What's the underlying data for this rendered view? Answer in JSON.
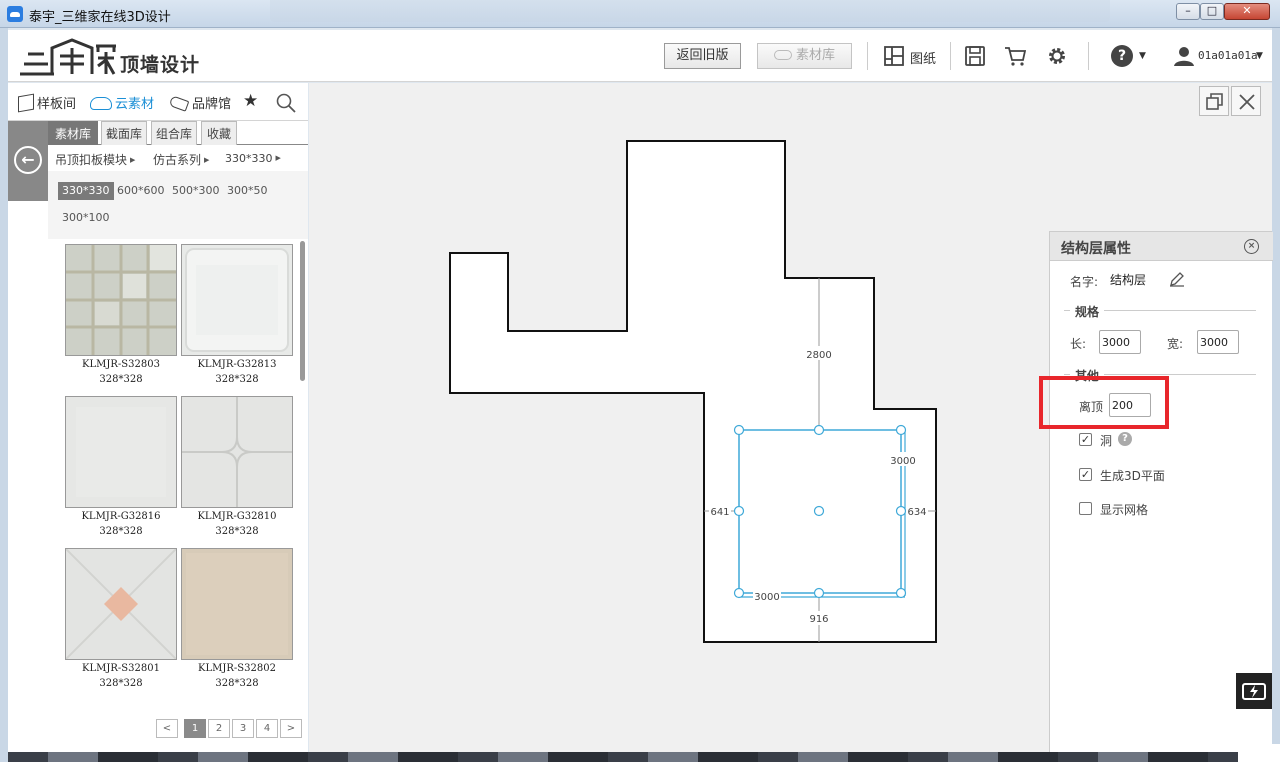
{
  "window": {
    "title": "泰宇_三维家在线3D设计",
    "min_glyph": "–",
    "max_glyph": "□",
    "close_glyph": "✕"
  },
  "header": {
    "logo_text": "顶墙设计",
    "return_old": "返回旧版",
    "material_library": "素材库",
    "drawings": "图纸",
    "help_glyph": "?",
    "username": "01a01a01a"
  },
  "left_panel": {
    "nav": [
      {
        "label": "样板间",
        "icon": "cube-icon"
      },
      {
        "label": "云素材",
        "icon": "cloud-icon"
      },
      {
        "label": "品牌馆",
        "icon": "tag-icon"
      }
    ],
    "back_glyph": "←",
    "tabs": [
      "素材库",
      "截面库",
      "组合库",
      "收藏"
    ],
    "active_tab": "素材库",
    "breadcrumbs": [
      "吊顶扣板模块",
      "仿古系列",
      "330*330"
    ],
    "sizes": [
      "330*330",
      "600*600",
      "500*300",
      "300*50",
      "300*100"
    ],
    "active_size": "330*330",
    "items": [
      {
        "name": "KLMJR-S32803",
        "dim": "328*328"
      },
      {
        "name": "KLMJR-G32813",
        "dim": "328*328"
      },
      {
        "name": "KLMJR-G32816",
        "dim": "328*328"
      },
      {
        "name": "KLMJR-G32810",
        "dim": "328*328"
      },
      {
        "name": "KLMJR-S32801",
        "dim": "328*328"
      },
      {
        "name": "KLMJR-S32802",
        "dim": "328*328"
      }
    ],
    "pager": {
      "prev": "<",
      "pages": [
        "1",
        "2",
        "3",
        "4"
      ],
      "active_page": "1",
      "next": ">"
    }
  },
  "canvas": {
    "dimensions": {
      "top_gap": "2800",
      "right_gap": "634",
      "left_gap": "641",
      "bottom_gap": "916",
      "rect_width": "3000",
      "rect_height": "3000"
    }
  },
  "properties": {
    "title": "结构层属性",
    "close_glyph": "×",
    "name_label": "名字:",
    "name_value": "结构层",
    "spec_section": "规格",
    "length_label": "长:",
    "length_value": "3000",
    "width_label": "宽:",
    "width_value": "3000",
    "other_section": "其他",
    "offset_label": "离顶",
    "offset_value": "200",
    "hole_label": "洞",
    "hole_checked": true,
    "gen3d_label": "生成3D平面",
    "gen3d_checked": true,
    "grid_label": "显示网格",
    "grid_checked": false,
    "check_glyph": "✓",
    "help_glyph": "?"
  },
  "colors": {
    "accent_blue": "#1b8fd6",
    "selection_cyan": "#3fa9d8",
    "highlight_red": "#e8262b"
  }
}
